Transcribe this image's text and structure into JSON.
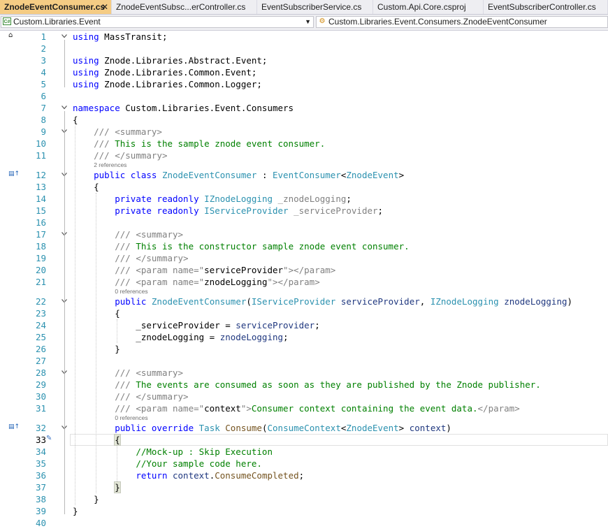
{
  "tabs": [
    {
      "label": "ZnodeEventConsumer.cs",
      "active": true,
      "close": "✕"
    },
    {
      "label": "ZnodeEventSubsc...erController.cs",
      "active": false
    },
    {
      "label": "EventSubscriberService.cs",
      "active": false
    },
    {
      "label": "Custom.Api.Core.csproj",
      "active": false
    },
    {
      "label": "EventSubscriberController.cs",
      "active": false
    }
  ],
  "navbar": {
    "project": "Custom.Libraries.Event",
    "project_icon": "C#",
    "type_member": "Custom.Libraries.Event.Consumers.ZnodeEventConsumer"
  },
  "editor": {
    "current_line": 33,
    "lines": [
      {
        "n": 1,
        "tokens": [
          [
            "kw",
            "using"
          ],
          [
            "",
            "MassTransit;"
          ]
        ]
      },
      {
        "n": 2,
        "tokens": []
      },
      {
        "n": 3,
        "tokens": [
          [
            "kw",
            "using"
          ],
          [
            "",
            " Znode.Libraries.Abstract.Event;"
          ]
        ]
      },
      {
        "n": 4,
        "tokens": [
          [
            "kw",
            "using"
          ],
          [
            "",
            " Znode.Libraries.Common.Event;"
          ]
        ]
      },
      {
        "n": 5,
        "tokens": [
          [
            "kw",
            "using"
          ],
          [
            "",
            " Znode.Libraries.Common.Logger;"
          ]
        ]
      },
      {
        "n": 6,
        "tokens": []
      },
      {
        "n": 7,
        "tokens": [
          [
            "kw",
            "namespace"
          ],
          [
            "",
            " Custom.Libraries.Event.Consumers"
          ]
        ]
      },
      {
        "n": 8,
        "tokens": [
          [
            "",
            "{"
          ]
        ]
      },
      {
        "n": 9,
        "tokens": [
          [
            "",
            "    "
          ],
          [
            "cmg",
            "/// <summary>"
          ]
        ]
      },
      {
        "n": 10,
        "tokens": [
          [
            "",
            "    "
          ],
          [
            "cmg",
            "///"
          ],
          [
            "cm",
            " This is the sample znode event consumer."
          ]
        ]
      },
      {
        "n": 11,
        "tokens": [
          [
            "",
            "    "
          ],
          [
            "cmg",
            "/// </summary>"
          ]
        ]
      },
      {
        "n": 12,
        "lens": "2 references",
        "tokens": [
          [
            "",
            "    "
          ],
          [
            "kw",
            "public class"
          ],
          [
            "",
            " "
          ],
          [
            "ty",
            "ZnodeEventConsumer"
          ],
          [
            "",
            " : "
          ],
          [
            "ty",
            "EventConsumer"
          ],
          [
            "",
            "<"
          ],
          [
            "ty",
            "ZnodeEvent"
          ],
          [
            "",
            ">"
          ]
        ]
      },
      {
        "n": 13,
        "tokens": [
          [
            "",
            "    {"
          ]
        ]
      },
      {
        "n": 14,
        "tokens": [
          [
            "",
            "        "
          ],
          [
            "kw",
            "private readonly"
          ],
          [
            "",
            " "
          ],
          [
            "ty",
            "IZnodeLogging"
          ],
          [
            "",
            " "
          ],
          [
            "uf",
            "_znodeLogging"
          ],
          [
            "",
            ";"
          ]
        ]
      },
      {
        "n": 15,
        "tokens": [
          [
            "",
            "        "
          ],
          [
            "kw",
            "private readonly"
          ],
          [
            "",
            " "
          ],
          [
            "ty",
            "IServiceProvider"
          ],
          [
            "",
            " "
          ],
          [
            "uf",
            "_serviceProvider"
          ],
          [
            "",
            ";"
          ]
        ]
      },
      {
        "n": 16,
        "tokens": []
      },
      {
        "n": 17,
        "tokens": [
          [
            "",
            "        "
          ],
          [
            "cmg",
            "/// <summary>"
          ]
        ]
      },
      {
        "n": 18,
        "tokens": [
          [
            "",
            "        "
          ],
          [
            "cmg",
            "///"
          ],
          [
            "cm",
            " This is the constructor sample znode event consumer."
          ]
        ]
      },
      {
        "n": 19,
        "tokens": [
          [
            "",
            "        "
          ],
          [
            "cmg",
            "/// </summary>"
          ]
        ]
      },
      {
        "n": 20,
        "tokens": [
          [
            "",
            "        "
          ],
          [
            "cmg",
            "/// <param name=\""
          ],
          [
            "",
            "serviceProvider"
          ],
          [
            "cmg",
            "\"></param>"
          ]
        ]
      },
      {
        "n": 21,
        "tokens": [
          [
            "",
            "        "
          ],
          [
            "cmg",
            "/// <param name=\""
          ],
          [
            "",
            "znodeLogging"
          ],
          [
            "cmg",
            "\"></param>"
          ]
        ]
      },
      {
        "n": 22,
        "lens": "0 references",
        "tokens": [
          [
            "",
            "        "
          ],
          [
            "kw",
            "public"
          ],
          [
            "",
            " "
          ],
          [
            "ty",
            "ZnodeEventConsumer"
          ],
          [
            "",
            "("
          ],
          [
            "ty",
            "IServiceProvider"
          ],
          [
            "",
            " "
          ],
          [
            "pr",
            "serviceProvider"
          ],
          [
            "",
            ", "
          ],
          [
            "ty",
            "IZnodeLogging"
          ],
          [
            "",
            " "
          ],
          [
            "pr",
            "znodeLogging"
          ],
          [
            "",
            ")"
          ]
        ]
      },
      {
        "n": 23,
        "tokens": [
          [
            "",
            "        {"
          ]
        ]
      },
      {
        "n": 24,
        "tokens": [
          [
            "",
            "            _serviceProvider = "
          ],
          [
            "pr",
            "serviceProvider"
          ],
          [
            "",
            ";"
          ]
        ]
      },
      {
        "n": 25,
        "tokens": [
          [
            "",
            "            _znodeLogging = "
          ],
          [
            "pr",
            "znodeLogging"
          ],
          [
            "",
            ";"
          ]
        ]
      },
      {
        "n": 26,
        "tokens": [
          [
            "",
            "        }"
          ]
        ]
      },
      {
        "n": 27,
        "tokens": []
      },
      {
        "n": 28,
        "tokens": [
          [
            "",
            "        "
          ],
          [
            "cmg",
            "/// <summary>"
          ]
        ]
      },
      {
        "n": 29,
        "tokens": [
          [
            "",
            "        "
          ],
          [
            "cmg",
            "///"
          ],
          [
            "cm",
            " The events are consumed as soon as they are published by the Znode publisher."
          ]
        ]
      },
      {
        "n": 30,
        "tokens": [
          [
            "",
            "        "
          ],
          [
            "cmg",
            "/// </summary>"
          ]
        ]
      },
      {
        "n": 31,
        "tokens": [
          [
            "",
            "        "
          ],
          [
            "cmg",
            "/// <param name=\""
          ],
          [
            "",
            "context"
          ],
          [
            "cmg",
            "\">"
          ],
          [
            "cm",
            "Consumer context containing the event data."
          ],
          [
            "cmg",
            "</param>"
          ]
        ]
      },
      {
        "n": 32,
        "lens": "0 references",
        "tokens": [
          [
            "",
            "        "
          ],
          [
            "kw",
            "public override"
          ],
          [
            "",
            " "
          ],
          [
            "ty",
            "Task"
          ],
          [
            "",
            " "
          ],
          [
            "mt",
            "Consume"
          ],
          [
            "",
            "("
          ],
          [
            "ty",
            "ConsumeContext"
          ],
          [
            "",
            "<"
          ],
          [
            "ty",
            "ZnodeEvent"
          ],
          [
            "",
            "> "
          ],
          [
            "pr",
            "context"
          ],
          [
            "",
            ")"
          ]
        ]
      },
      {
        "n": 33,
        "tokens": [
          [
            "",
            "        "
          ],
          [
            "brace",
            "{"
          ]
        ]
      },
      {
        "n": 34,
        "tokens": [
          [
            "",
            "            "
          ],
          [
            "cm",
            "//Mock-up : Skip Execution"
          ]
        ]
      },
      {
        "n": 35,
        "tokens": [
          [
            "",
            "            "
          ],
          [
            "cm",
            "//Your sample code here."
          ]
        ]
      },
      {
        "n": 36,
        "tokens": [
          [
            "",
            "            "
          ],
          [
            "kw",
            "return"
          ],
          [
            "",
            " "
          ],
          [
            "pr",
            "context"
          ],
          [
            "",
            "."
          ],
          [
            "mt",
            "ConsumeCompleted"
          ],
          [
            "",
            ";"
          ]
        ]
      },
      {
        "n": 37,
        "tokens": [
          [
            "",
            "        "
          ],
          [
            "brace",
            "}"
          ]
        ]
      },
      {
        "n": 38,
        "tokens": [
          [
            "",
            "    }"
          ]
        ]
      },
      {
        "n": 39,
        "tokens": [
          [
            "",
            "}"
          ]
        ]
      },
      {
        "n": 40,
        "tokens": []
      }
    ]
  }
}
